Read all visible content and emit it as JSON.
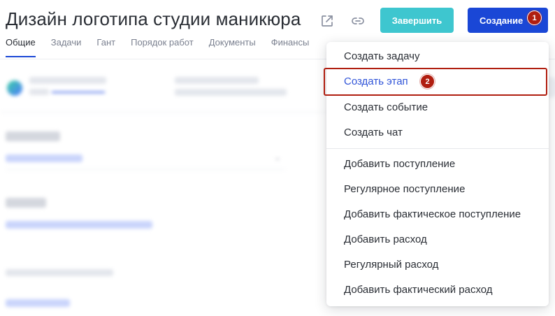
{
  "header": {
    "title": "Дизайн логотипа студии маникюра",
    "icons": [
      "external-link-icon",
      "link-icon"
    ],
    "finish_label": "Завершить",
    "create_label": "Создание",
    "create_badge": "1"
  },
  "tabs": [
    {
      "label": "Общие",
      "active": true
    },
    {
      "label": "Задачи"
    },
    {
      "label": "Гант"
    },
    {
      "label": "Порядок работ"
    },
    {
      "label": "Документы"
    },
    {
      "label": "Финансы"
    }
  ],
  "dropdown": {
    "highlight_badge": "2",
    "group_main": [
      {
        "label": "Создать задачу"
      },
      {
        "label": "Создать этап",
        "highlighted": true
      },
      {
        "label": "Создать событие"
      },
      {
        "label": "Создать чат"
      }
    ],
    "group_finance": [
      {
        "label": "Добавить поступление"
      },
      {
        "label": "Регулярное поступление"
      },
      {
        "label": "Добавить фактическое поступление"
      },
      {
        "label": "Добавить расход"
      },
      {
        "label": "Регулярный расход"
      },
      {
        "label": "Добавить фактический расход"
      }
    ]
  },
  "colors": {
    "accent": "#1a47d6",
    "finish": "#3ec6cf",
    "annotation": "#b01e10"
  }
}
